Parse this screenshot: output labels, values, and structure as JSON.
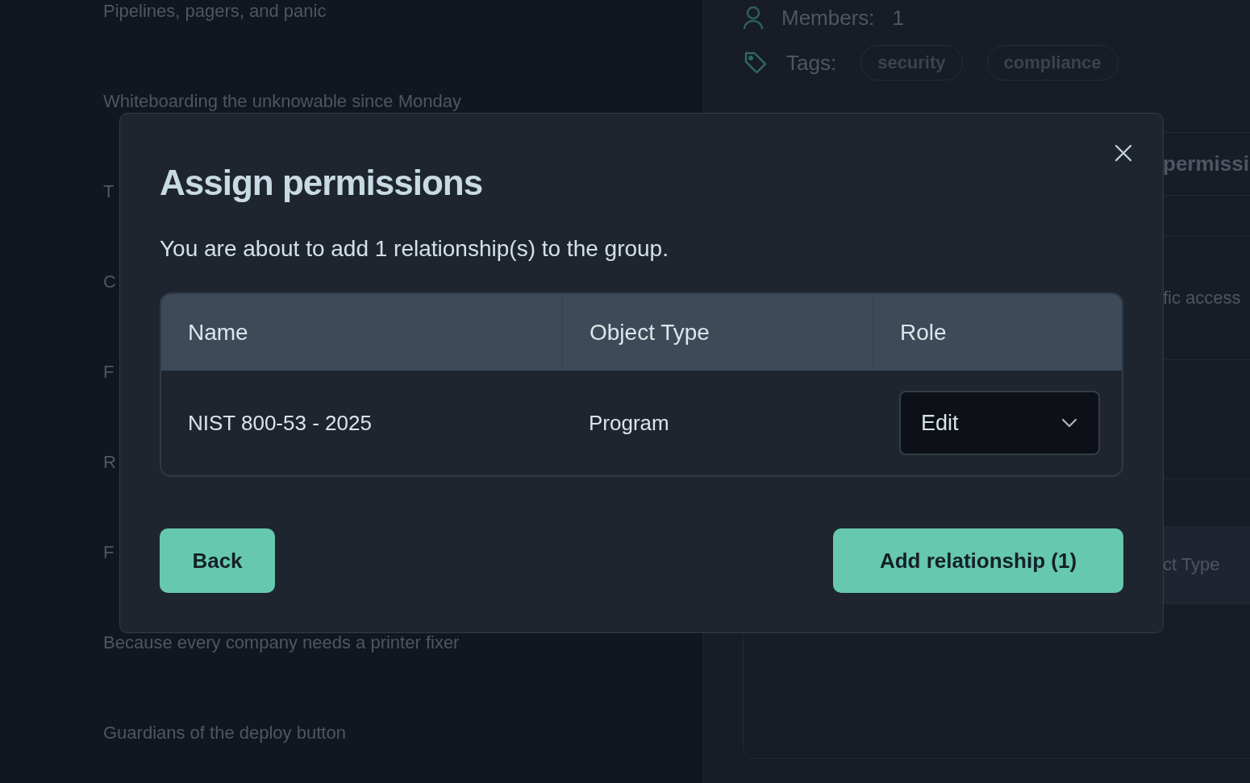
{
  "background": {
    "list_items": [
      "Pipelines, pagers, and panic",
      "Whiteboarding the unknowable since Monday",
      "T",
      "C",
      "F",
      "R",
      "F",
      "Because every company needs a printer fixer",
      "Guardians of the deploy button"
    ],
    "details": {
      "members_label": "Members:",
      "members_count": "1",
      "tags_label": "Tags:",
      "tags": [
        "security",
        "compliance"
      ],
      "card_texts": [
        "permissi",
        "fic access"
      ],
      "table_header": "ct Type"
    }
  },
  "dialog": {
    "title": "Assign permissions",
    "message": "You are about to add 1 relationship(s) to the group.",
    "columns": [
      "Name",
      "Object Type",
      "Role"
    ],
    "rows": [
      {
        "name": "NIST 800-53 - 2025",
        "object_type": "Program",
        "role": "Edit"
      }
    ],
    "buttons": [
      {
        "kind": "secondary",
        "label": "Back"
      },
      {
        "kind": "primary",
        "label": "Add relationship (1)"
      }
    ]
  }
}
